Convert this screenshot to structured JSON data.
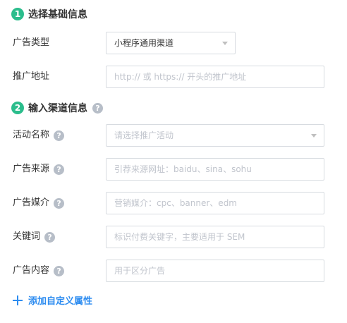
{
  "section1": {
    "step": "1",
    "title": "选择基础信息",
    "ad_type": {
      "label": "广告类型",
      "value": "小程序通用渠道"
    },
    "ad_address": {
      "label": "推广地址",
      "placeholder": "http:// 或 https:// 开头的推广地址"
    }
  },
  "section2": {
    "step": "2",
    "title": "输入渠道信息",
    "help": "?",
    "campaign_name": {
      "label": "活动名称",
      "help": "?",
      "placeholder": "请选择推广活动"
    },
    "ad_source": {
      "label": "广告来源",
      "help": "?",
      "placeholder": "引荐来源网址：baidu、sina、sohu"
    },
    "ad_medium": {
      "label": "广告媒介",
      "help": "?",
      "placeholder": "营销媒介：cpc、banner、edm"
    },
    "keyword": {
      "label": "关键词",
      "help": "?",
      "placeholder": "标识付费关键字，主要适用于 SEM"
    },
    "ad_content": {
      "label": "广告内容",
      "help": "?",
      "placeholder": "用于区分广告"
    }
  },
  "add_custom_attribute": {
    "label": "添加自定义属性",
    "icon": "plus-icon"
  },
  "colors": {
    "step_badge": "#2bbd8c",
    "link": "#2d8cf0",
    "help_icon": "#b7bec8",
    "border": "#d7dbe0",
    "placeholder": "#c0c4cc"
  }
}
